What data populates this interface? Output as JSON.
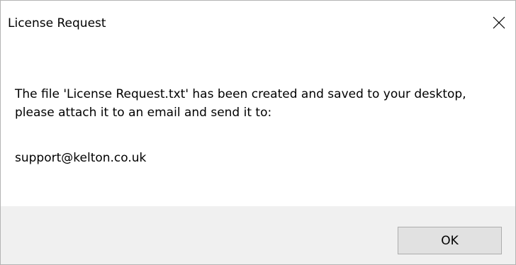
{
  "window": {
    "title": "License Request"
  },
  "icons": {
    "close": "close-icon"
  },
  "content": {
    "message": "The file 'License Request.txt' has been created and saved to your desktop, please attach it to an email and send it to:",
    "email": "support@kelton.co.uk"
  },
  "footer": {
    "ok_label": "OK"
  },
  "colors": {
    "footer_background": "#f0f0f0",
    "button_background": "#e1e1e1",
    "button_border": "#adadad",
    "window_border": "#b4b4b4"
  }
}
